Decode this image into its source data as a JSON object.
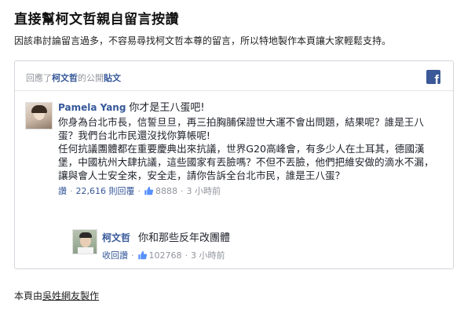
{
  "page": {
    "title": "直接幫柯文哲親自留言按讚",
    "intro": "因該串討論留言過多，不容易尋找柯文哲本尊的留言，所以特地製作本頁讓大家輕鬆支持。",
    "footer_prefix": "本頁由",
    "footer_link": "吳姓網友製作"
  },
  "card": {
    "header_prefix": "回應了",
    "header_author": "柯文哲",
    "header_middle": "的公開",
    "header_post": "貼文",
    "fb_icon": "facebook-icon"
  },
  "comment": {
    "author": "Pamela Yang",
    "headline": "你才是王八蛋吧!",
    "body": "你身為台北市長，信誓旦旦，再三拍胸脯保證世大運不會出問題，結果呢？誰是王八蛋？我們台北市民還沒找你算帳呢!\n任何抗議團體都在重要慶典出來抗議，世界G20高峰會，有多少人在土耳其，德國漢堡，中國杭州大肆抗議，這些國家有丟臉嗎？不但不丟臉，他們把維安做的滴水不漏，讓與會人士安全來，安全走，請你告訴全台北市民，誰是王八蛋？",
    "like_action": "讚",
    "reply_count": "22,616 則回覆",
    "likes": "8888",
    "time": "3 小時前"
  },
  "reply": {
    "author": "柯文哲",
    "text": "你和那些反年改團體",
    "unlike_action": "收回讚",
    "likes": "102768",
    "time": "3 小時前"
  }
}
